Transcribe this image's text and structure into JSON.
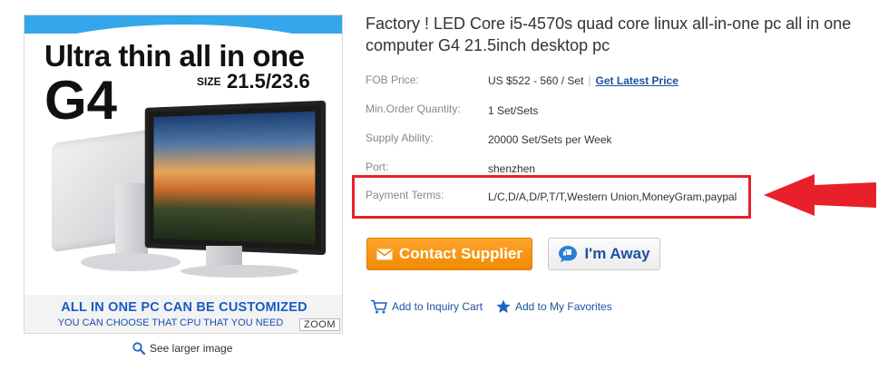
{
  "image": {
    "headline": "Ultra thin all in one",
    "model": "G4",
    "size_label": "SIZE",
    "size_value": "21.5/23.6",
    "banner_line1": "ALL IN ONE PC CAN BE CUSTOMIZED",
    "banner_line2": "YOU CAN CHOOSE THAT CPU THAT YOU NEED",
    "zoom_label": "ZOOM",
    "see_larger": "See larger image"
  },
  "product": {
    "title": "Factory ! LED Core i5-4570s quad core linux all-in-one pc all in one computer G4 21.5inch desktop pc",
    "attributes": [
      {
        "label": "FOB Price:",
        "value": "US $522 - 560 / Set"
      },
      {
        "label": "Min.Order Quantity:",
        "value": "1 Set/Sets"
      },
      {
        "label": "Supply Ability:",
        "value": "20000 Set/Sets per Week"
      },
      {
        "label": "Port:",
        "value": "shenzhen"
      },
      {
        "label": "Payment Terms:",
        "value": "L/C,D/A,D/P,T/T,Western Union,MoneyGram,paypal"
      }
    ],
    "price_separator": "|",
    "price_link": "Get Latest Price"
  },
  "actions": {
    "contact_label": "Contact Supplier",
    "away_label": "I'm Away",
    "inquiry_label": "Add to Inquiry Cart",
    "favorites_label": "Add to My Favorites"
  },
  "colors": {
    "accent_orange": "#f08a00",
    "link_blue": "#1e50a2",
    "highlight_red": "#e8202a"
  }
}
